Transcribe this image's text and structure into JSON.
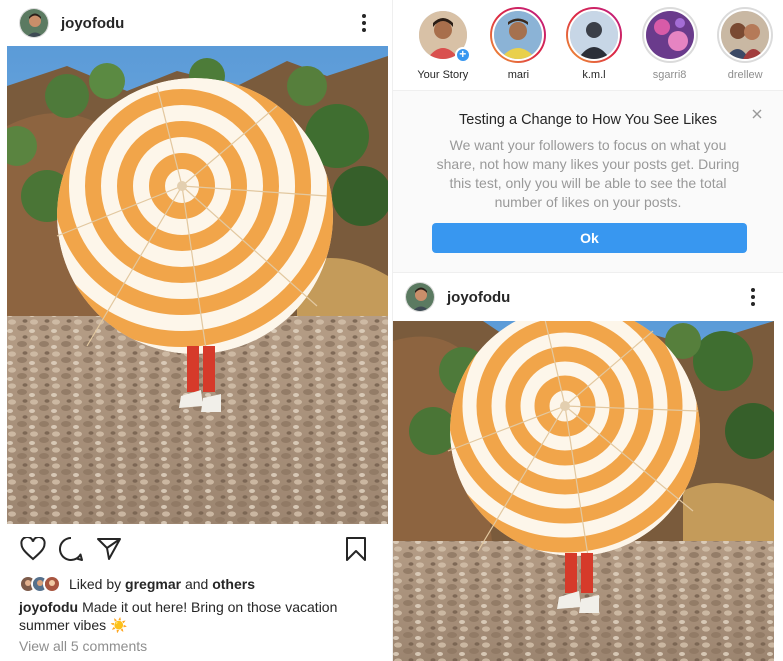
{
  "colors": {
    "link_blue": "#3897f0",
    "muted": "#8e8e8e",
    "text": "#262626"
  },
  "left_post": {
    "username": "joyofodu",
    "likes": {
      "prefix": "Liked by",
      "user": "gregmar",
      "and": "and",
      "others": "others"
    },
    "caption": {
      "user": "joyofodu",
      "text": "Made it out here! Bring on those vacation summer vibes ☀️"
    },
    "view_comments": "View all 5 comments",
    "icons": [
      "heart-icon",
      "comment-icon",
      "share-icon",
      "bookmark-icon",
      "more-icon"
    ]
  },
  "stories": [
    {
      "name": "Your Story",
      "state": "own"
    },
    {
      "name": "mari",
      "state": "unseen"
    },
    {
      "name": "k.m.l",
      "state": "unseen"
    },
    {
      "name": "sgarri8",
      "state": "seen"
    },
    {
      "name": "drellew",
      "state": "seen"
    }
  ],
  "notice": {
    "title": "Testing a Change to How You See Likes",
    "body": "We want your followers to focus on what you share, not how many likes your posts get. During this test, only you will be able to see the total number of likes on your posts.",
    "button": "Ok"
  },
  "right_post": {
    "username": "joyofodu"
  }
}
